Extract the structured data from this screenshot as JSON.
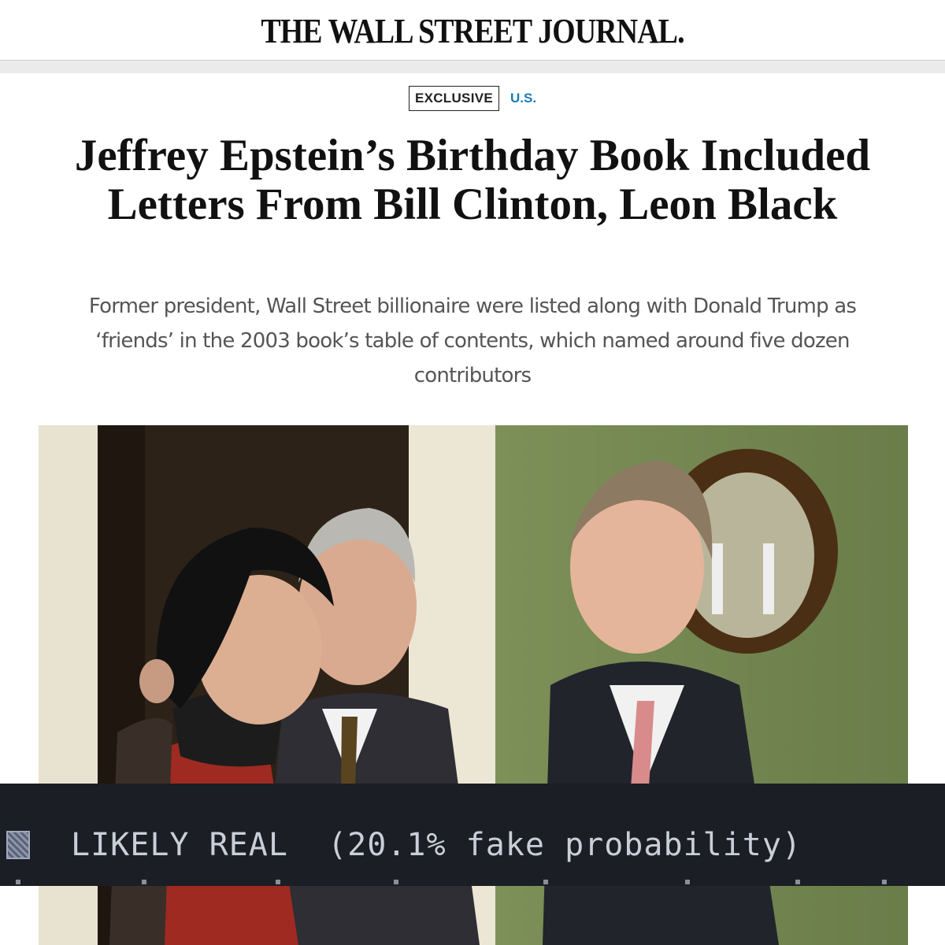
{
  "header": {
    "logo": "THE WALL STREET JOURNAL."
  },
  "article": {
    "badge": "EXCLUSIVE",
    "section": "U.S.",
    "headline": "Jeffrey Epstein’s Birthday Book Included Letters From Bill Clinton, Leon Black",
    "dek": "Former president, Wall Street billionaire were listed along with Donald Trump as ‘friends’ in the 2003 book’s table of contents, which named around five dozen contributors"
  },
  "overlay": {
    "verdict": "LIKELY REAL",
    "detail": "(20.1% fake probability)"
  },
  "colors": {
    "section_link": "#1a7bb8",
    "overlay_bg": "#1b1e24",
    "overlay_text": "#c9ced8"
  }
}
